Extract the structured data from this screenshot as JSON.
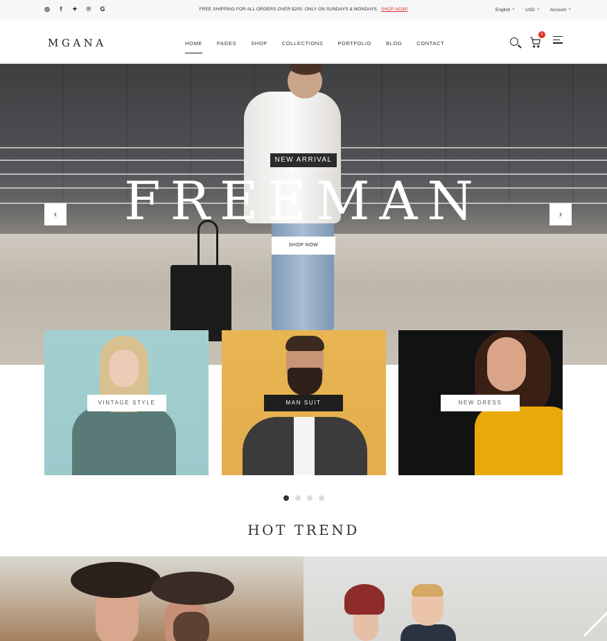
{
  "topbar": {
    "social_icons": [
      "instagram-icon",
      "facebook-icon",
      "twitter-icon",
      "pinterest-icon",
      "google-icon"
    ],
    "promo_text": "FREE SHIPPING FOR ALL ORDERS OVER $200. ONLY ON SUNDAYS & MONDAYS.",
    "promo_link": "SHOP NOW!",
    "language": "English",
    "currency": "USD",
    "account": "Account"
  },
  "header": {
    "logo": "MGANA",
    "nav": [
      "HOME",
      "PAGES",
      "SHOP",
      "COLLECTIONS",
      "PORTFOLIO",
      "BLOG",
      "CONTACT"
    ],
    "active_nav": "HOME",
    "cart_count": "0"
  },
  "hero": {
    "tag": "NEW ARRIVAL",
    "headline": "FREEMAN",
    "button": "SHOP NOW",
    "prev_arrow": "‹",
    "next_arrow": "›"
  },
  "categories": [
    {
      "label": "VINTAGE STYLE"
    },
    {
      "label": "MAN SUIT"
    },
    {
      "label": "NEW DRESS"
    }
  ],
  "carousel": {
    "pages": 4,
    "active": 1
  },
  "hot_trend": {
    "title": "HOT TREND"
  },
  "colors": {
    "accent": "#d33a2c",
    "dark": "#222222",
    "topbar_bg": "#f6f7f9"
  }
}
